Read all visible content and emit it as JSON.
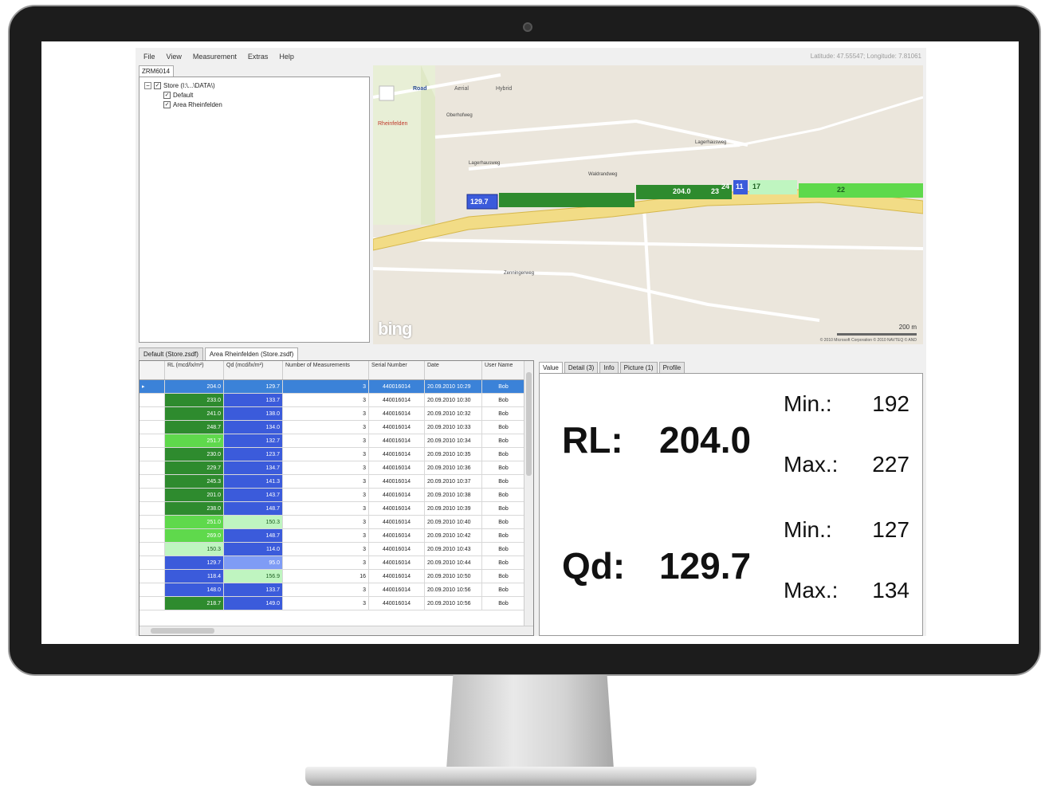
{
  "menu": [
    "File",
    "View",
    "Measurement",
    "Extras",
    "Help"
  ],
  "coords": "Latitude: 47.55547; Longitude: 7.81061",
  "tree": {
    "tab": "ZRM6014",
    "root": "Store (I:\\...\\DATA\\)",
    "children": [
      "Default",
      "Area Rheinfelden"
    ]
  },
  "map": {
    "types": [
      "Road",
      "Aerial",
      "Hybrid"
    ],
    "town": "Rheinfelden",
    "streets": [
      "Oberhofweg",
      "Lagerhausweg",
      "Waldrandweg",
      "Lagerhausweg",
      "Zenningerweg"
    ],
    "logo": "bing",
    "scale": "200 m",
    "copyright": "© 2010 Microsoft Corporation   © 2010 NAVTEQ   © AND",
    "markers": [
      "129.7",
      "204.0",
      "11",
      "17",
      "23",
      "24",
      "22"
    ]
  },
  "bottom_tabs": [
    "Default (Store.zsdf)",
    "Area Rheinfelden (Store.zsdf)"
  ],
  "grid": {
    "headers": [
      "RL (mcd/lx/m²)",
      "Qd (mcd/lx/m²)",
      "Number of Measurements",
      "Serial Number",
      "Date",
      "User Name"
    ],
    "rows": [
      {
        "rl": "204.0",
        "qd": "129.7",
        "n": "3",
        "serial": "440016014",
        "date": "20.09.2010 10:29",
        "user": "Bob",
        "rlc": "#2e8b2e",
        "qdc": "#3b5bdb"
      },
      {
        "rl": "233.0",
        "qd": "133.7",
        "n": "3",
        "serial": "440016014",
        "date": "20.09.2010 10:30",
        "user": "Bob",
        "rlc": "#2e8b2e",
        "qdc": "#3b5bdb"
      },
      {
        "rl": "241.0",
        "qd": "138.0",
        "n": "3",
        "serial": "440016014",
        "date": "20.09.2010 10:32",
        "user": "Bob",
        "rlc": "#2e8b2e",
        "qdc": "#3b5bdb"
      },
      {
        "rl": "248.7",
        "qd": "134.0",
        "n": "3",
        "serial": "440016014",
        "date": "20.09.2010 10:33",
        "user": "Bob",
        "rlc": "#2e8b2e",
        "qdc": "#3b5bdb"
      },
      {
        "rl": "251.7",
        "qd": "132.7",
        "n": "3",
        "serial": "440016014",
        "date": "20.09.2010 10:34",
        "user": "Bob",
        "rlc": "#5fd94c",
        "qdc": "#3b5bdb"
      },
      {
        "rl": "230.0",
        "qd": "123.7",
        "n": "3",
        "serial": "440016014",
        "date": "20.09.2010 10:35",
        "user": "Bob",
        "rlc": "#2e8b2e",
        "qdc": "#3b5bdb"
      },
      {
        "rl": "229.7",
        "qd": "134.7",
        "n": "3",
        "serial": "440016014",
        "date": "20.09.2010 10:36",
        "user": "Bob",
        "rlc": "#2e8b2e",
        "qdc": "#3b5bdb"
      },
      {
        "rl": "245.3",
        "qd": "141.3",
        "n": "3",
        "serial": "440016014",
        "date": "20.09.2010 10:37",
        "user": "Bob",
        "rlc": "#2e8b2e",
        "qdc": "#3b5bdb"
      },
      {
        "rl": "201.0",
        "qd": "143.7",
        "n": "3",
        "serial": "440016014",
        "date": "20.09.2010 10:38",
        "user": "Bob",
        "rlc": "#2e8b2e",
        "qdc": "#3b5bdb"
      },
      {
        "rl": "238.0",
        "qd": "148.7",
        "n": "3",
        "serial": "440016014",
        "date": "20.09.2010 10:39",
        "user": "Bob",
        "rlc": "#2e8b2e",
        "qdc": "#3b5bdb"
      },
      {
        "rl": "251.0",
        "qd": "150.3",
        "n": "3",
        "serial": "440016014",
        "date": "20.09.2010 10:40",
        "user": "Bob",
        "rlc": "#5fd94c",
        "qdc": "#bff5c0"
      },
      {
        "rl": "269.0",
        "qd": "148.7",
        "n": "3",
        "serial": "440016014",
        "date": "20.09.2010 10:42",
        "user": "Bob",
        "rlc": "#5fd94c",
        "qdc": "#3b5bdb"
      },
      {
        "rl": "150.3",
        "qd": "114.0",
        "n": "3",
        "serial": "440016014",
        "date": "20.09.2010 10:43",
        "user": "Bob",
        "rlc": "#bff5c0",
        "qdc": "#3b5bdb"
      },
      {
        "rl": "129.7",
        "qd": "95.0",
        "n": "3",
        "serial": "440016014",
        "date": "20.09.2010 10:44",
        "user": "Bob",
        "rlc": "#3b5bdb",
        "qdc": "#7f9cf5"
      },
      {
        "rl": "118.4",
        "qd": "156.9",
        "n": "16",
        "serial": "440016014",
        "date": "20.09.2010 10:50",
        "user": "Bob",
        "rlc": "#3b5bdb",
        "qdc": "#bff5c0"
      },
      {
        "rl": "148.0",
        "qd": "133.7",
        "n": "3",
        "serial": "440016014",
        "date": "20.09.2010 10:56",
        "user": "Bob",
        "rlc": "#3b5bdb",
        "qdc": "#3b5bdb"
      },
      {
        "rl": "218.7",
        "qd": "149.0",
        "n": "3",
        "serial": "440016014",
        "date": "20.09.2010 10:56",
        "user": "Bob",
        "rlc": "#2e8b2e",
        "qdc": "#3b5bdb"
      }
    ]
  },
  "value_tabs": [
    "Value",
    "Detail (3)",
    "Info",
    "Picture (1)",
    "Profile"
  ],
  "values": {
    "rl_label": "RL:",
    "rl_value": "204.0",
    "qd_label": "Qd:",
    "qd_value": "129.7",
    "min_label": "Min.:",
    "max_label": "Max.:",
    "rl_min": "192",
    "rl_max": "227",
    "qd_min": "127",
    "qd_max": "134"
  }
}
